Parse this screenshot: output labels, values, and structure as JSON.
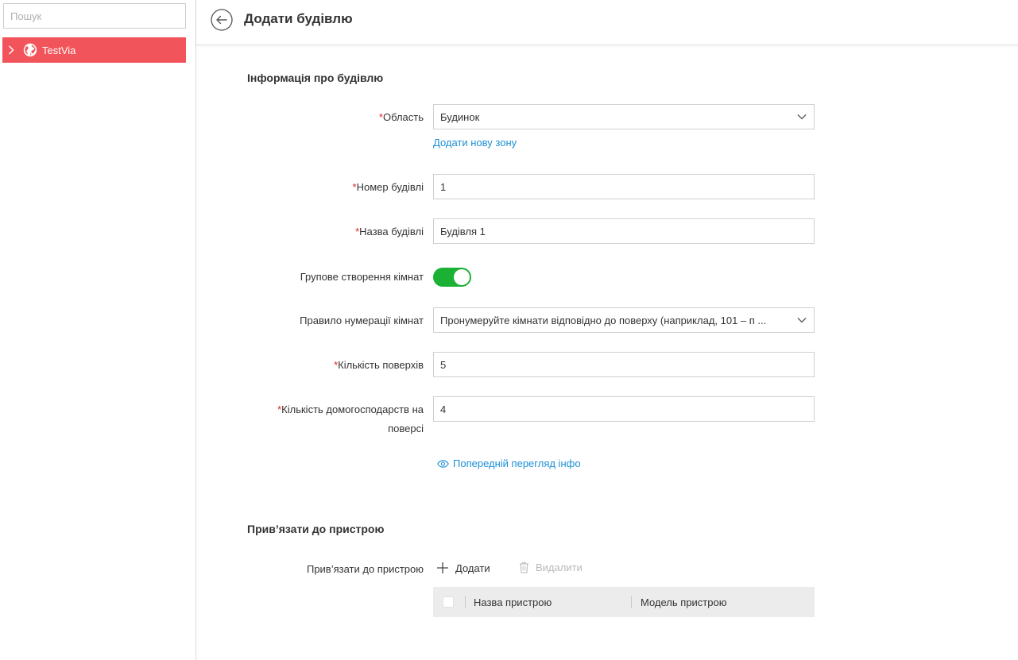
{
  "sidebar": {
    "search_placeholder": "Пошук",
    "tree": [
      {
        "label": "TestVia",
        "icon": "globe-icon",
        "expanded": false,
        "selected": true
      }
    ]
  },
  "header": {
    "title": "Додати будівлю"
  },
  "building_info": {
    "section_title": "Інформація про будівлю",
    "area": {
      "label": "Область",
      "value": "Будинок",
      "add_zone_link": "Додати нову зону"
    },
    "building_number": {
      "label": "Номер будівлі",
      "value": "1"
    },
    "building_name": {
      "label": "Назва будівлі",
      "value": "Будівля 1"
    },
    "batch_rooms": {
      "label": "Групове створення кімнат",
      "enabled": true
    },
    "room_numbering": {
      "label": "Правило нумерації кімнат",
      "value": "Пронумеруйте кімнати відповідно до поверху (наприклад, 101 – п ..."
    },
    "floors": {
      "label": "Кількість поверхів",
      "value": "5"
    },
    "households_per_floor": {
      "label": "Кількість домогосподарств на поверсі",
      "value": "4"
    },
    "preview_link": "Попередній перегляд інфо"
  },
  "link_device": {
    "section_title": "Прив’язати до пристрою",
    "label": "Прив’язати до пристрою",
    "add_label": "Додати",
    "delete_label": "Видалити",
    "columns": [
      "Назва пристрою",
      "Модель пристрою"
    ]
  },
  "colors": {
    "accent": "#f2545b",
    "link": "#1b8fd6",
    "toggle_on": "#1ab135",
    "required": "#e02020"
  }
}
